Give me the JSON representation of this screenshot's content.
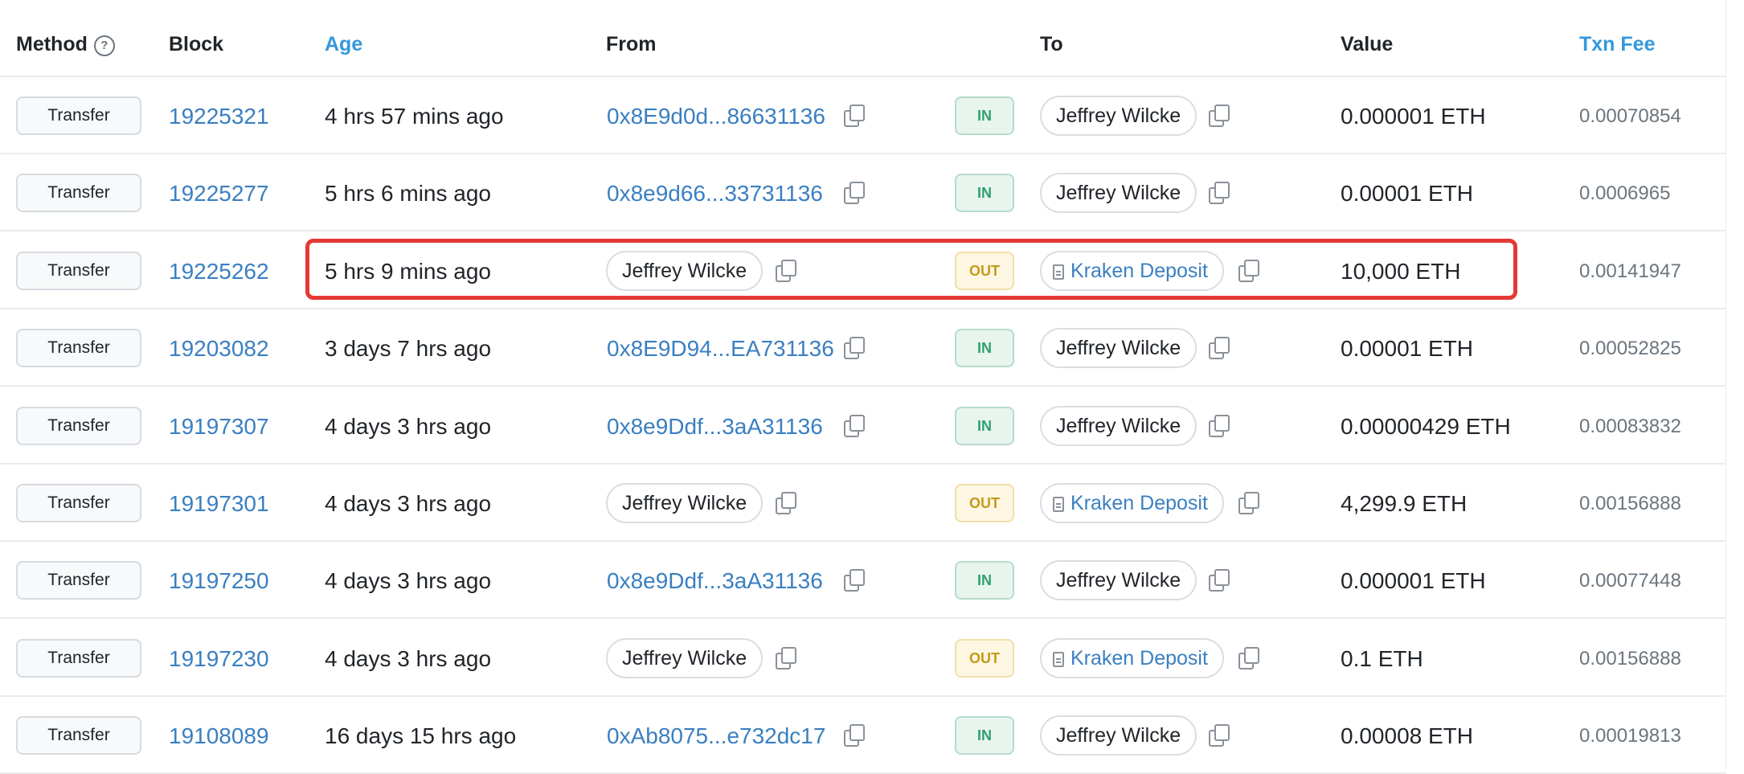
{
  "columns": {
    "method": "Method",
    "block": "Block",
    "age": "Age",
    "from": "From",
    "to": "To",
    "value": "Value",
    "txn_fee": "Txn Fee"
  },
  "help_glyph": "?",
  "rows": [
    {
      "method": "Transfer",
      "block": "19225321",
      "age": "4 hrs 57 mins ago",
      "from": "0x8E9d0d...86631136",
      "from_type": "address",
      "direction": "IN",
      "to": "Jeffrey Wilcke",
      "to_type": "name",
      "value": "0.000001 ETH",
      "fee": "0.00070854"
    },
    {
      "method": "Transfer",
      "block": "19225277",
      "age": "5 hrs 6 mins ago",
      "from": "0x8e9d66...33731136",
      "from_type": "address",
      "direction": "IN",
      "to": "Jeffrey Wilcke",
      "to_type": "name",
      "value": "0.00001 ETH",
      "fee": "0.0006965"
    },
    {
      "method": "Transfer",
      "block": "19225262",
      "age": "5 hrs 9 mins ago",
      "from": "Jeffrey Wilcke",
      "from_type": "name",
      "direction": "OUT",
      "to": "Kraken Deposit",
      "to_type": "contract",
      "value": "10,000 ETH",
      "fee": "0.00141947"
    },
    {
      "method": "Transfer",
      "block": "19203082",
      "age": "3 days 7 hrs ago",
      "from": "0x8E9D94...EA731136",
      "from_type": "address",
      "direction": "IN",
      "to": "Jeffrey Wilcke",
      "to_type": "name",
      "value": "0.00001 ETH",
      "fee": "0.00052825"
    },
    {
      "method": "Transfer",
      "block": "19197307",
      "age": "4 days 3 hrs ago",
      "from": "0x8e9Ddf...3aA31136",
      "from_type": "address",
      "direction": "IN",
      "to": "Jeffrey Wilcke",
      "to_type": "name",
      "value": "0.00000429 ETH",
      "fee": "0.00083832"
    },
    {
      "method": "Transfer",
      "block": "19197301",
      "age": "4 days 3 hrs ago",
      "from": "Jeffrey Wilcke",
      "from_type": "name",
      "direction": "OUT",
      "to": "Kraken Deposit",
      "to_type": "contract",
      "value": "4,299.9 ETH",
      "fee": "0.00156888"
    },
    {
      "method": "Transfer",
      "block": "19197250",
      "age": "4 days 3 hrs ago",
      "from": "0x8e9Ddf...3aA31136",
      "from_type": "address",
      "direction": "IN",
      "to": "Jeffrey Wilcke",
      "to_type": "name",
      "value": "0.000001 ETH",
      "fee": "0.00077448"
    },
    {
      "method": "Transfer",
      "block": "19197230",
      "age": "4 days 3 hrs ago",
      "from": "Jeffrey Wilcke",
      "from_type": "name",
      "direction": "OUT",
      "to": "Kraken Deposit",
      "to_type": "contract",
      "value": "0.1 ETH",
      "fee": "0.00156888"
    },
    {
      "method": "Transfer",
      "block": "19108089",
      "age": "16 days 15 hrs ago",
      "from": "0xAb8075...e732dc17",
      "from_type": "address",
      "direction": "IN",
      "to": "Jeffrey Wilcke",
      "to_type": "name",
      "value": "0.00008 ETH",
      "fee": "0.00019813"
    }
  ],
  "highlighted_row": 2,
  "colors": {
    "link": "#3a7fc1",
    "in_badge": "#2f9f6e",
    "out_badge": "#c49a19",
    "highlight": "#e53935"
  }
}
